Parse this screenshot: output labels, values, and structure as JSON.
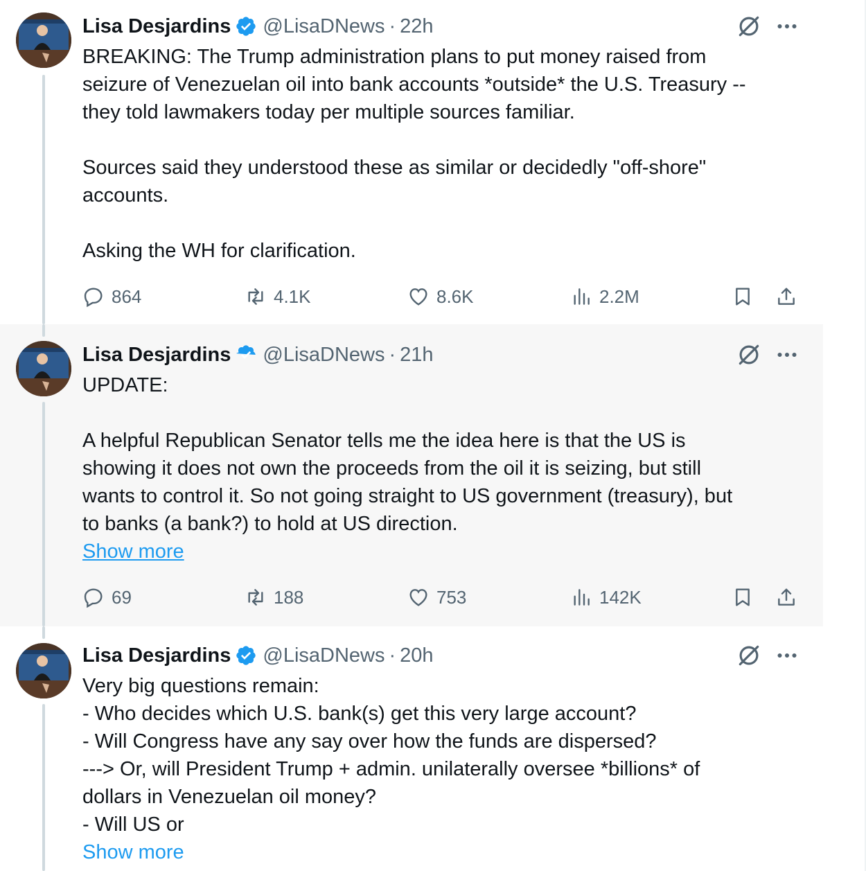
{
  "tweets": [
    {
      "author_name": "Lisa Desjardins",
      "handle": "@LisaDNews",
      "separator": "·",
      "time": "22h",
      "lines": [
        "BREAKING: The Trump administration plans to put money raised from",
        "seizure of Venezuelan oil into bank accounts *outside* the U.S. Treasury --",
        "they told lawmakers today per multiple sources familiar.",
        "",
        "Sources said they understood these as similar or decidedly \"off-shore\"",
        "accounts.",
        "",
        "Asking the WH for clarification."
      ],
      "stats": {
        "replies": "864",
        "retweets": "4.1K",
        "likes": "8.6K",
        "views": "2.2M"
      }
    },
    {
      "author_name": "Lisa Desjardins",
      "handle": "@LisaDNews",
      "separator": "·",
      "time": "21h",
      "lines": [
        "UPDATE:",
        "",
        "A helpful Republican Senator tells me the idea here is that the US is",
        "showing it does not own the proceeds from the oil it is seizing,  but still",
        "wants to control it. So not going straight to US government (treasury), but",
        "to banks (a bank?) to hold at US direction."
      ],
      "show_more": "Show more",
      "stats": {
        "replies": "69",
        "retweets": "188",
        "likes": "753",
        "views": "142K"
      }
    },
    {
      "author_name": "Lisa Desjardins",
      "handle": "@LisaDNews",
      "separator": "·",
      "time": "20h",
      "lines": [
        "Very big questions remain:",
        "- Who decides which U.S. bank(s) get this very large account?",
        "- Will Congress have any say over how the funds are dispersed?",
        "---> Or, will President Trump + admin. unilaterally oversee *billions* of",
        "dollars in Venezuelan oil money?",
        "- Will US or"
      ],
      "show_more": "Show more"
    }
  ],
  "colors": {
    "verified_badge": "#1d9bf0",
    "link": "#1d9bf0",
    "secondary_text": "#536471",
    "thread_line": "#cfd9de",
    "highlight_bg": "#f7f7f7"
  },
  "icons": [
    "verified-badge-icon",
    "grok-icon",
    "more-icon",
    "reply-icon",
    "retweet-icon",
    "like-icon",
    "views-icon",
    "bookmark-icon",
    "share-icon"
  ]
}
